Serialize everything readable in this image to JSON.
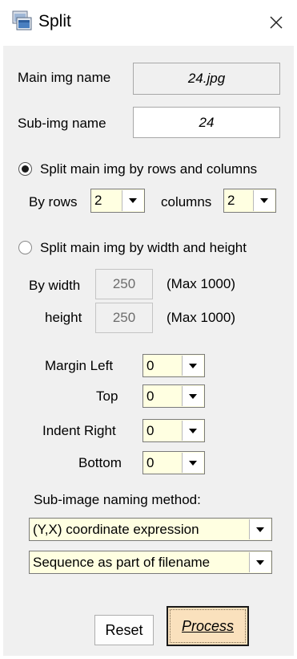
{
  "window": {
    "title": "Split"
  },
  "main_img": {
    "label": "Main img name",
    "value": "24.jpg"
  },
  "sub_img": {
    "label": "Sub-img name",
    "value": "24"
  },
  "mode_rows_cols": {
    "label": "Split main img by rows and columns",
    "selected": true,
    "rows_label": "By rows",
    "rows_value": "2",
    "columns_label": "columns",
    "columns_value": "2"
  },
  "mode_width_height": {
    "label": "Split main img by width and height",
    "selected": false,
    "width_label": "By width",
    "width_value": "250",
    "width_max": "(Max 1000)",
    "height_label": "height",
    "height_value": "250",
    "height_max": "(Max 1000)"
  },
  "margins": {
    "left_label": "Margin Left",
    "left_value": "0",
    "top_label": "Top",
    "top_value": "0",
    "right_label": "Indent Right",
    "right_value": "0",
    "bottom_label": "Bottom",
    "bottom_value": "0"
  },
  "naming": {
    "label": "Sub-image naming method:",
    "method_value": "(Y,X) coordinate expression",
    "sequence_value": "Sequence as part of filename"
  },
  "buttons": {
    "reset": "Reset",
    "process": "Process"
  },
  "icons": {
    "app": "split-window-icon",
    "close": "close-icon",
    "dropdown": "chevron-down-icon"
  }
}
